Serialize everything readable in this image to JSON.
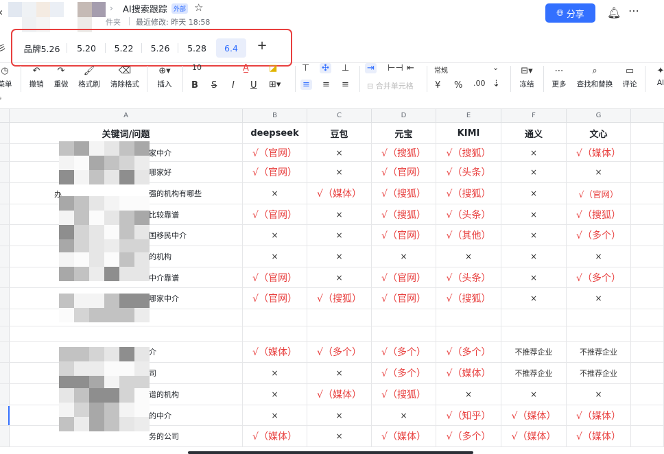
{
  "header": {
    "title": "AI搜索跟踪",
    "external_tag": "外部",
    "folder_text": "件夹",
    "modified": "最近修改: 昨天 18:58",
    "share_label": "分享"
  },
  "tabs": [
    "品牌5.26",
    "5.20",
    "5.22",
    "5.26",
    "5.28",
    "6.4"
  ],
  "active_tab": "6.4",
  "toolbar": {
    "cut_label": "菜单",
    "undo": "撤销",
    "redo": "重做",
    "format_painter": "格式刷",
    "clear_format": "清除格式",
    "insert": "插入",
    "font_size": "10",
    "merge": "合并单元格",
    "number_format": "常规",
    "currency": "¥",
    "percent": "%",
    "freeze": "冻结",
    "more": "更多",
    "find_replace": "查找和替换",
    "comment": "评论",
    "ai": "AI"
  },
  "accent_color": "#3370ff",
  "mark_color": "#e8403f",
  "columns": [
    "A",
    "B",
    "C",
    "D",
    "E",
    "F",
    "G"
  ],
  "table": {
    "headers": [
      "关键词/问题",
      "deepseek",
      "豆包",
      "元宝",
      "KIMI",
      "通义",
      "文心"
    ],
    "rows": [
      {
        "q": "家中介",
        "v": [
          "√（官网）",
          "×",
          "√（搜狐）",
          "√（搜狐）",
          "×",
          "√（媒体）"
        ]
      },
      {
        "q": "哪家好",
        "v": [
          "√（官网）",
          "×",
          "√（官网）",
          "√（头条）",
          "×",
          "×"
        ]
      },
      {
        "q": "强的机构有哪些",
        "v": [
          "×",
          "√（媒体）",
          "√（搜狐）",
          "√（搜狐）",
          "×",
          "√（官网）"
        ]
      },
      {
        "q": "比较靠谱",
        "v": [
          "√（官网）",
          "×",
          "√（搜狐）",
          "√（头条）",
          "×",
          "√（搜狐）"
        ]
      },
      {
        "q": "国移民中介",
        "v": [
          "×",
          "×",
          "√（官网）",
          "√（其他）",
          "×",
          "√（多个）"
        ]
      },
      {
        "q": "的机构",
        "v": [
          "×",
          "×",
          "×",
          "×",
          "×",
          "×"
        ]
      },
      {
        "q": "中介靠谱",
        "v": [
          "√（官网）",
          "×",
          "√（官网）",
          "√（头条）",
          "×",
          "√（多个）"
        ]
      },
      {
        "q": "哪家中介",
        "v": [
          "√（官网）",
          "√（搜狐）",
          "√（官网）",
          "√（搜狐）",
          "×",
          "×"
        ]
      },
      {
        "q": "",
        "v": [
          "",
          "",
          "",
          "",
          "",
          ""
        ]
      },
      {
        "q": "",
        "v": [
          "",
          "",
          "",
          "",
          "",
          ""
        ]
      },
      {
        "q": "介",
        "v": [
          "√（媒体）",
          "√（多个）",
          "√（多个）",
          "√（多个）",
          "不推荐企业",
          "不推荐企业"
        ]
      },
      {
        "q": "司",
        "v": [
          "×",
          "×",
          "√（多个）",
          "√（媒体）",
          "不推荐企业",
          "不推荐企业"
        ]
      },
      {
        "q": "谱的机构",
        "v": [
          "×",
          "√（媒体）",
          "√（搜狐）",
          "×",
          "×",
          "×"
        ]
      },
      {
        "q": "的中介",
        "v": [
          "×",
          "×",
          "×",
          "√（知乎）",
          "√（媒体）",
          "√（媒体）"
        ]
      },
      {
        "q": "务的公司",
        "v": [
          "√（媒体）",
          "×",
          "√（媒体）",
          "√（多个）",
          "√（媒体）",
          "√（媒体）"
        ]
      }
    ]
  },
  "stray_text": "办"
}
